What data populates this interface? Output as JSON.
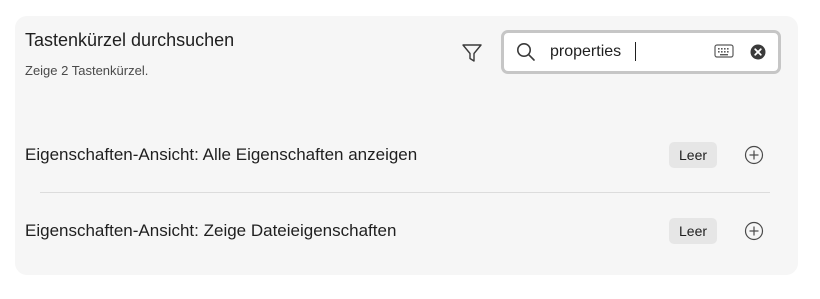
{
  "header": {
    "title": "Tastenkürzel durchsuchen",
    "subtitle": "Zeige 2 Tastenkürzel."
  },
  "search": {
    "value": "properties",
    "filter_icon": "filter-icon",
    "search_icon": "search-icon",
    "keyboard_icon": "keyboard-icon",
    "clear_icon": "clear-icon"
  },
  "hotkeys": [
    {
      "label": "Eigenschaften-Ansicht: Alle Eigenschaften anzeigen",
      "binding": "Leer",
      "add_icon": "add-icon"
    },
    {
      "label": "Eigenschaften-Ansicht: Zeige Dateieigenschaften",
      "binding": "Leer",
      "add_icon": "add-icon"
    }
  ],
  "colors": {
    "panel_background": "#f6f6f6",
    "badge_background": "#e6e6e6",
    "search_border": "#c6c6c6"
  }
}
